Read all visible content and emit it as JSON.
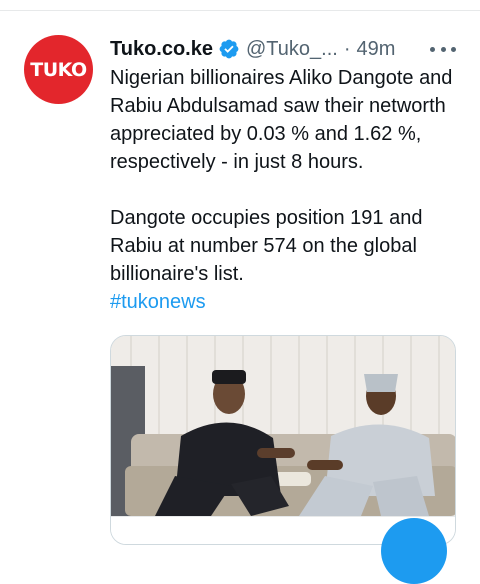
{
  "tweet": {
    "display_name": "Tuko.co.ke",
    "handle": "@Tuko_...",
    "separator": "·",
    "time": "49m",
    "avatar_text": "TUKO",
    "paragraph1": "Nigerian billionaires Aliko Dangote and Rabiu Abdulsamad saw their networth appreciated by 0.03 % and 1.62 %, respectively - in just 8 hours.",
    "paragraph2": "Dangote occupies position 191 and Rabiu at number 574 on the global billionaire's list.",
    "hashtag": "#tukonews"
  },
  "icons": {
    "verified": "verified-badge-icon",
    "more": "more-options-icon"
  },
  "colors": {
    "accent": "#1d9bf0",
    "avatar_bg": "#e3262c",
    "text": "#0f1419",
    "muted": "#536471"
  }
}
